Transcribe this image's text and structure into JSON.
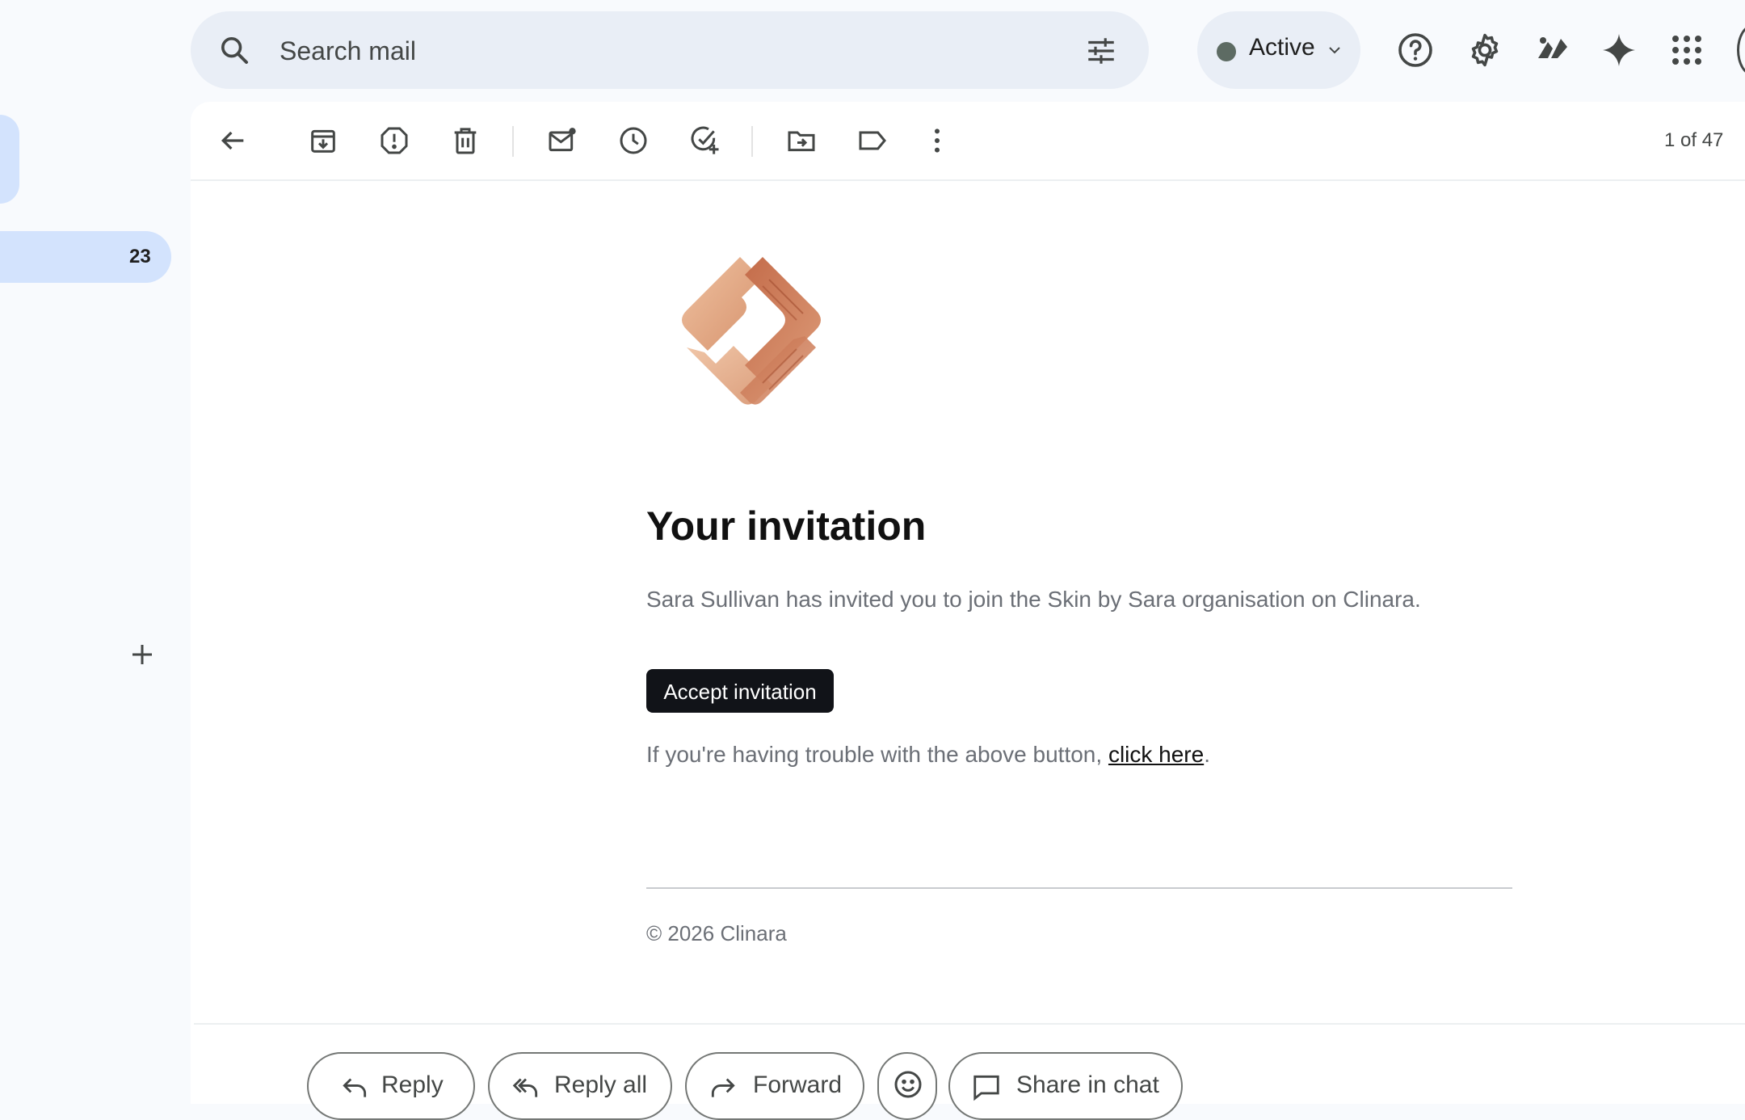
{
  "search": {
    "placeholder": "Search mail"
  },
  "status": {
    "label": "Active",
    "dot_color": "#5d6b63"
  },
  "top_icons": [
    "help-icon",
    "settings-icon",
    "apps-widget-icon",
    "gemini-icon",
    "google-apps-icon"
  ],
  "sidebar": {
    "badge_count": "23"
  },
  "toolbar": {
    "icons": [
      "back-arrow-icon",
      "archive-icon",
      "report-spam-icon",
      "delete-icon",
      "mark-unread-icon",
      "snooze-icon",
      "add-to-tasks-icon",
      "move-to-icon",
      "label-icon",
      "more-icon"
    ],
    "pager": "1 of 47"
  },
  "email": {
    "brand_color": "#c67a58",
    "title": "Your invitation",
    "body": "Sara Sullivan has invited you to join the Skin by Sara organisation on Clinara.",
    "accept_label": "Accept invitation",
    "trouble_prefix": "If you're having trouble with the above button, ",
    "trouble_link": "click here",
    "trouble_suffix": ".",
    "copyright": "© 2026 Clinara"
  },
  "actions": {
    "reply": "Reply",
    "reply_all": "Reply all",
    "forward": "Forward",
    "share": "Share in chat"
  }
}
